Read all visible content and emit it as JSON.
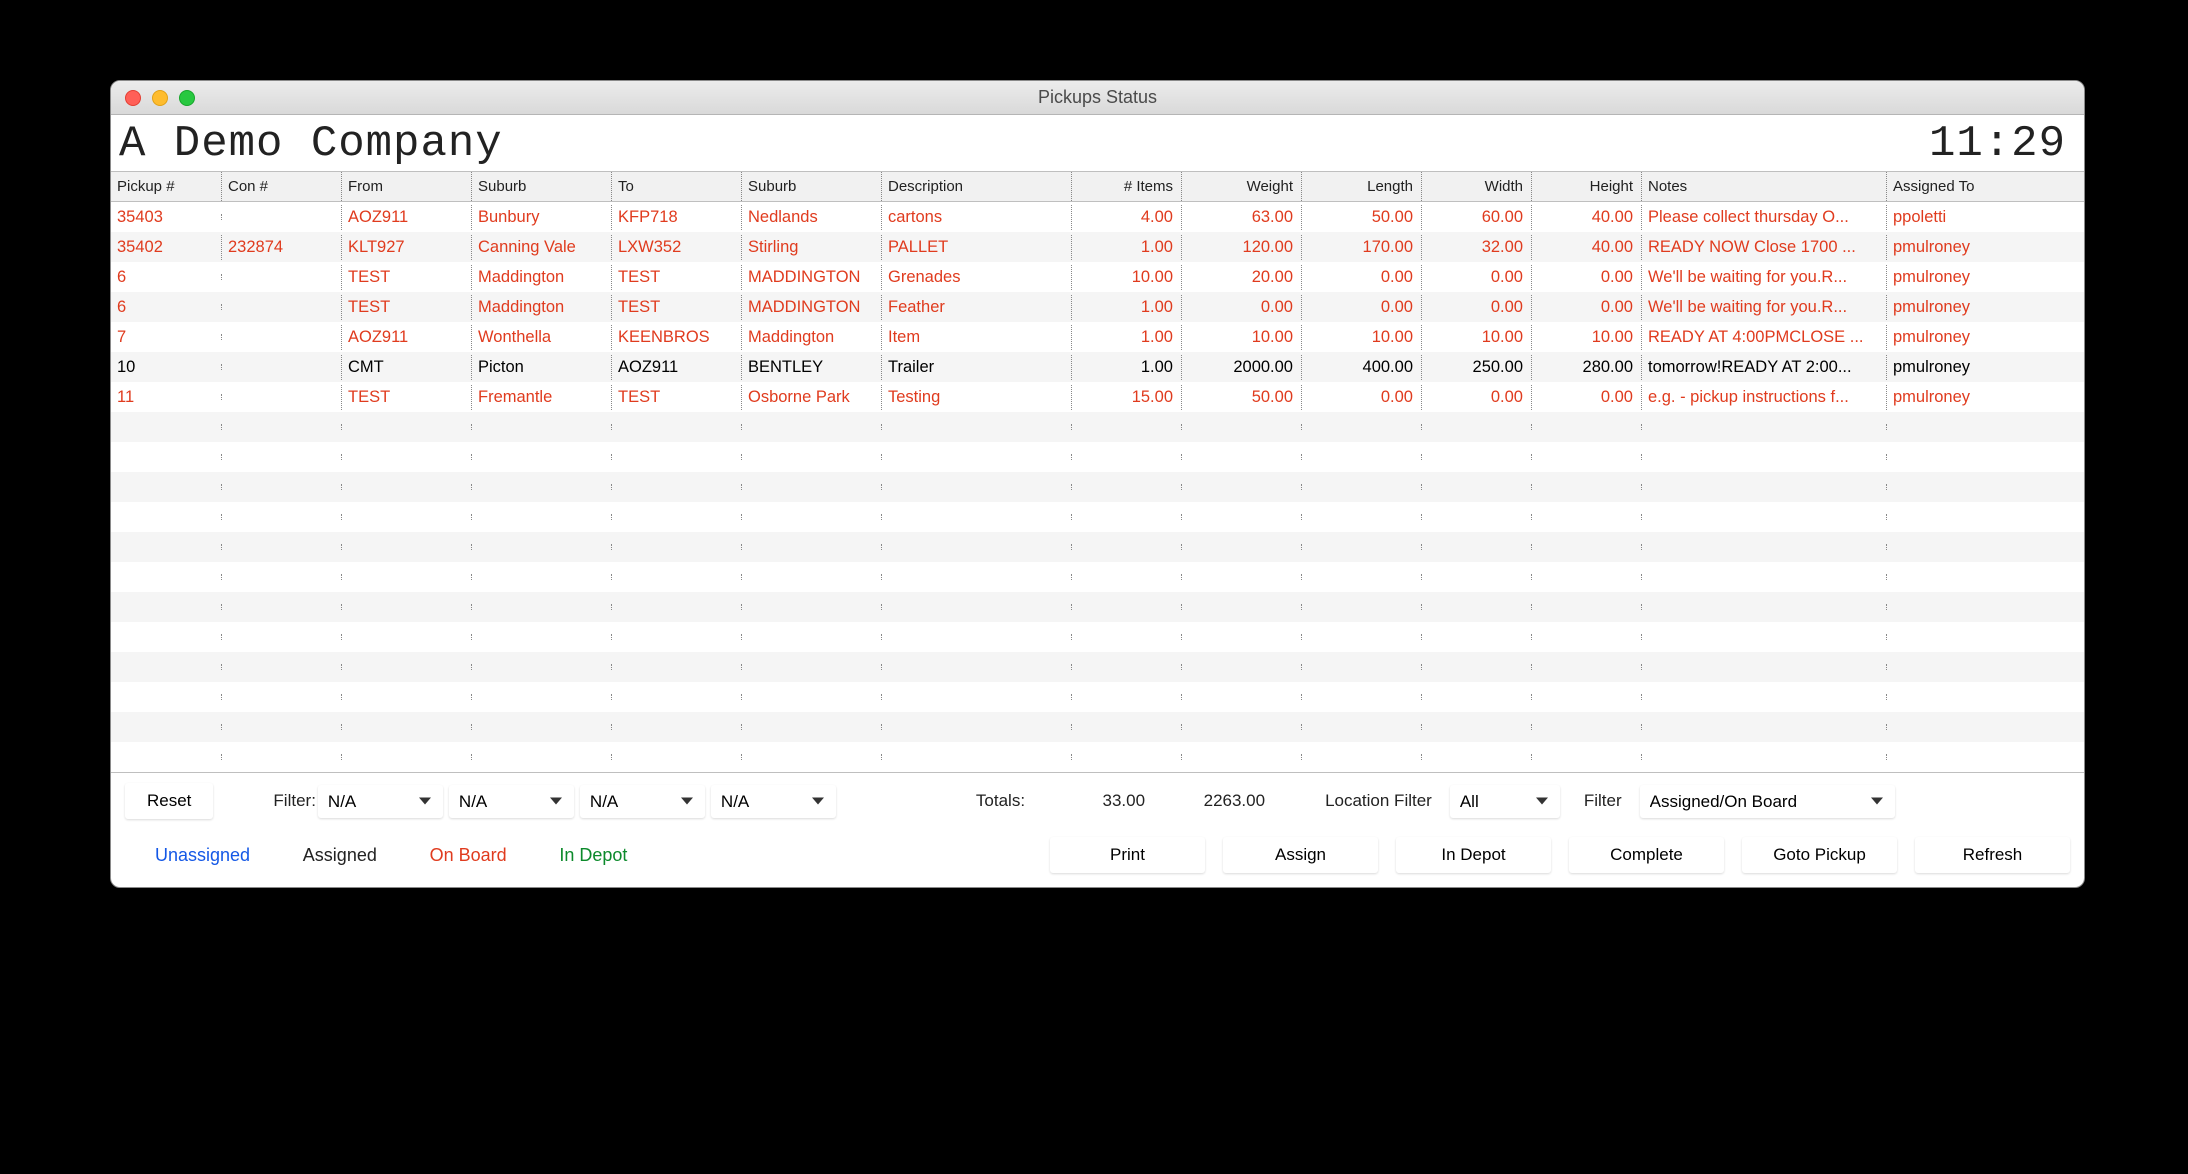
{
  "window": {
    "title": "Pickups Status"
  },
  "banner": {
    "company": "A Demo Company",
    "clock": "11:29"
  },
  "columns": {
    "pickup": "Pickup #",
    "con": "Con #",
    "from": "From",
    "suburb1": "Suburb",
    "to": "To",
    "suburb2": "Suburb",
    "desc": "Description",
    "items": "# Items",
    "weight": "Weight",
    "length": "Length",
    "width": "Width",
    "height": "Height",
    "notes": "Notes",
    "assigned": "Assigned To"
  },
  "rows": [
    {
      "color": "red",
      "pickup": "35403",
      "con": "",
      "from": "AOZ911",
      "suburb1": "Bunbury",
      "to": "KFP718",
      "suburb2": "Nedlands",
      "desc": "cartons",
      "items": "4.00",
      "weight": "63.00",
      "length": "50.00",
      "width": "60.00",
      "height": "40.00",
      "notes": "Please collect thursday O...",
      "assigned": "ppoletti"
    },
    {
      "color": "red",
      "pickup": "35402",
      "con": "232874",
      "from": "KLT927",
      "suburb1": "Canning Vale",
      "to": "LXW352",
      "suburb2": "Stirling",
      "desc": "PALLET",
      "items": "1.00",
      "weight": "120.00",
      "length": "170.00",
      "width": "32.00",
      "height": "40.00",
      "notes": "READY NOW Close 1700 ...",
      "assigned": "pmulroney"
    },
    {
      "color": "red",
      "pickup": "6",
      "con": "",
      "from": "TEST",
      "suburb1": "Maddington",
      "to": "TEST",
      "suburb2": "MADDINGTON",
      "desc": "Grenades",
      "items": "10.00",
      "weight": "20.00",
      "length": "0.00",
      "width": "0.00",
      "height": "0.00",
      "notes": "We'll be waiting for you.R...",
      "assigned": "pmulroney"
    },
    {
      "color": "red",
      "pickup": "6",
      "con": "",
      "from": "TEST",
      "suburb1": "Maddington",
      "to": "TEST",
      "suburb2": "MADDINGTON",
      "desc": "Feather",
      "items": "1.00",
      "weight": "0.00",
      "length": "0.00",
      "width": "0.00",
      "height": "0.00",
      "notes": "We'll be waiting for you.R...",
      "assigned": "pmulroney"
    },
    {
      "color": "red",
      "pickup": "7",
      "con": "",
      "from": "AOZ911",
      "suburb1": "Wonthella",
      "to": "KEENBROS",
      "suburb2": "Maddington",
      "desc": "Item",
      "items": "1.00",
      "weight": "10.00",
      "length": "10.00",
      "width": "10.00",
      "height": "10.00",
      "notes": "READY AT 4:00PMCLOSE ...",
      "assigned": "pmulroney"
    },
    {
      "color": "black",
      "pickup": "10",
      "con": "",
      "from": "CMT",
      "suburb1": "Picton",
      "to": "AOZ911",
      "suburb2": "BENTLEY",
      "desc": "Trailer",
      "items": "1.00",
      "weight": "2000.00",
      "length": "400.00",
      "width": "250.00",
      "height": "280.00",
      "notes": "tomorrow!READY AT 2:00...",
      "assigned": "pmulroney"
    },
    {
      "color": "red",
      "pickup": "11",
      "con": "",
      "from": "TEST",
      "suburb1": "Fremantle",
      "to": "TEST",
      "suburb2": "Osborne Park",
      "desc": "Testing",
      "items": "15.00",
      "weight": "50.00",
      "length": "0.00",
      "width": "0.00",
      "height": "0.00",
      "notes": "e.g. - pickup instructions f...",
      "assigned": "pmulroney"
    }
  ],
  "footer": {
    "reset": "Reset",
    "filter_label": "Filter:",
    "filter_values": [
      "N/A",
      "N/A",
      "N/A",
      "N/A"
    ],
    "totals_label": "Totals:",
    "totals_items": "33.00",
    "totals_weight": "2263.00",
    "location_filter_label": "Location Filter",
    "location_filter_value": "All",
    "filter2_label": "Filter",
    "filter2_value": "Assigned/On Board",
    "legend": {
      "unassigned": "Unassigned",
      "assigned": "Assigned",
      "onboard": "On Board",
      "indepot": "In Depot"
    },
    "buttons": {
      "print": "Print",
      "assign": "Assign",
      "indepot": "In Depot",
      "complete": "Complete",
      "goto": "Goto Pickup",
      "refresh": "Refresh"
    }
  }
}
